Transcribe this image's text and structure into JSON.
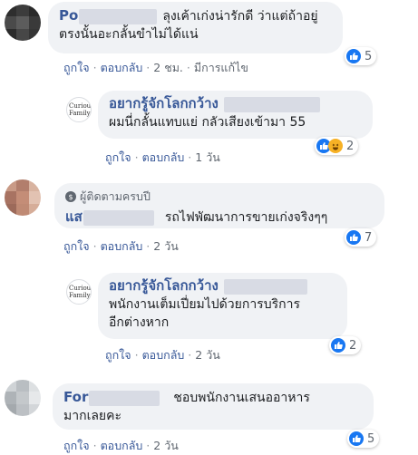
{
  "actions": {
    "like": "ถูกใจ",
    "reply": "ตอบกลับ",
    "separator": "·"
  },
  "comments": [
    {
      "author_visible": "Po",
      "text_line1": "ลุงเค้าเก่งน่ารักดี ว่าแต่ถ้าอยู่",
      "text_line2": "ตรงนั้นอะกลั้นขำไม่ได้แน่",
      "time": "2 ชม.",
      "edited": "มีการแก้ไข",
      "reaction_count": "5"
    },
    {
      "author_visible": "อยากรู้จักโลกกว้าง",
      "page_avatar_text": "Curious Family",
      "text_line1": "ผมนี่กลั้นแทบแย่ กลัวเสียงเข้ามา 55",
      "time": "1 วัน",
      "reaction_count": "2"
    },
    {
      "badge": "ผู้ติดตามครบปี",
      "badge_icon": "$",
      "author_visible": "แส",
      "text_line1": "รถไฟพัฒนาการขายเก่งจริงๆๆ",
      "time": "2 วัน",
      "reaction_count": "7"
    },
    {
      "author_visible": "อยากรู้จักโลกกว้าง",
      "page_avatar_text": "Curious Family",
      "text_line1": "พนักงานเต็มเปี่ยมไปด้วยการบริการ",
      "text_line2": "อีกต่างหาก",
      "time": "2 วัน",
      "reaction_count": "2"
    },
    {
      "author_visible": "For",
      "text_line1": "ชอบพนักงานเสนออาหาร",
      "text_line2": "มากเลยคะ",
      "time": "2 วัน",
      "reaction_count": "5"
    }
  ],
  "colors": {
    "link": "#385898",
    "like": "#1877f2",
    "haha": "#f7b125",
    "bubble": "#f0f2f5"
  },
  "icons": {
    "like": "thumbs-up-icon",
    "haha": "haha-emoji-icon"
  }
}
